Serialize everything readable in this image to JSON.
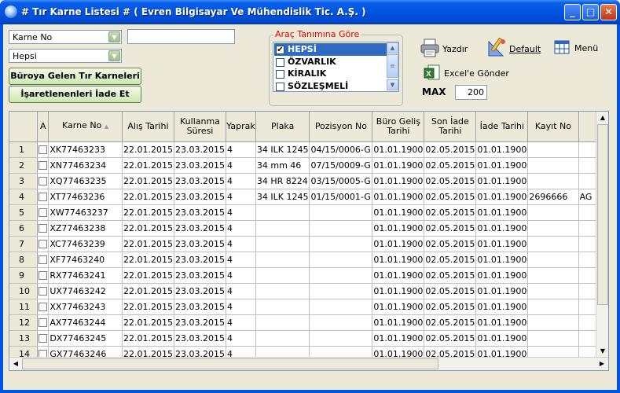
{
  "window": {
    "title": "# Tır Karne Listesi #  ( Evren Bilgisayar Ve Mühendislik Tic. A.Ş. )",
    "minimize_glyph": "_",
    "maximize_glyph": "□",
    "close_glyph": "✕"
  },
  "filters": {
    "field_combo_value": "Karne No",
    "search_value": "",
    "status_combo_value": "Hepsi",
    "arrow_glyph": "▼"
  },
  "buttons": {
    "incoming_label": "Büroya Gelen Tır Karneleri",
    "return_label": "İşaretlenenleri İade Et"
  },
  "vehicle_group": {
    "title": "Araç Tanımına Göre",
    "items": [
      {
        "label": "HEPSİ",
        "checked": true,
        "mark": "✔"
      },
      {
        "label": "ÖZVARLIK",
        "checked": false,
        "mark": ""
      },
      {
        "label": "KİRALIK",
        "checked": false,
        "mark": ""
      },
      {
        "label": "SÖZLEŞMELİ",
        "checked": false,
        "mark": ""
      }
    ]
  },
  "toolbar": {
    "print_label": "Yazdır",
    "default_label": "Default",
    "menu_label": "Menü",
    "excel_label": "Excel'e Gönder",
    "max_label": "MAX",
    "max_value": "200"
  },
  "table": {
    "headers": [
      "",
      "A",
      "Karne No",
      "Alış Tarihi",
      "Kullanma Süresi",
      "Yaprak",
      "Plaka",
      "Pozisyon No",
      "Büro Geliş Tarihi",
      "Son İade Tarihi",
      "İade Tarihi",
      "Kayıt No",
      ""
    ],
    "sort_glyph": "▲",
    "rows": [
      [
        "1",
        "XK77463233",
        "22.01.2015",
        "23.03.2015",
        "4",
        "34 ILK 1245",
        "04/15/0006-G",
        "01.01.1900",
        "02.05.2015",
        "01.01.1900",
        "",
        ""
      ],
      [
        "2",
        "XN77463234",
        "22.01.2015",
        "23.03.2015",
        "4",
        "34 mm 46",
        "07/15/0009-G",
        "01.01.1900",
        "02.05.2015",
        "01.01.1900",
        "",
        ""
      ],
      [
        "3",
        "XQ77463235",
        "22.01.2015",
        "23.03.2015",
        "4",
        "34 HR 8224",
        "03/15/0005-G",
        "01.01.1900",
        "02.05.2015",
        "01.01.1900",
        "",
        ""
      ],
      [
        "4",
        "XT77463236",
        "22.01.2015",
        "23.03.2015",
        "4",
        "34 ILK 1245",
        "01/15/0001-G",
        "01.01.1900",
        "02.05.2015",
        "01.01.1900",
        "2696666",
        "AG"
      ],
      [
        "5",
        "XW77463237",
        "22.01.2015",
        "23.03.2015",
        "4",
        "",
        "",
        "01.01.1900",
        "02.05.2015",
        "01.01.1900",
        "",
        ""
      ],
      [
        "6",
        "XZ77463238",
        "22.01.2015",
        "23.03.2015",
        "4",
        "",
        "",
        "01.01.1900",
        "02.05.2015",
        "01.01.1900",
        "",
        ""
      ],
      [
        "7",
        "XC77463239",
        "22.01.2015",
        "23.03.2015",
        "4",
        "",
        "",
        "01.01.1900",
        "02.05.2015",
        "01.01.1900",
        "",
        ""
      ],
      [
        "8",
        "XF77463240",
        "22.01.2015",
        "23.03.2015",
        "4",
        "",
        "",
        "01.01.1900",
        "02.05.2015",
        "01.01.1900",
        "",
        ""
      ],
      [
        "9",
        "RX77463241",
        "22.01.2015",
        "23.03.2015",
        "4",
        "",
        "",
        "01.01.1900",
        "02.05.2015",
        "01.01.1900",
        "",
        ""
      ],
      [
        "10",
        "UX77463242",
        "22.01.2015",
        "23.03.2015",
        "4",
        "",
        "",
        "01.01.1900",
        "02.05.2015",
        "01.01.1900",
        "",
        ""
      ],
      [
        "11",
        "XX77463243",
        "22.01.2015",
        "23.03.2015",
        "4",
        "",
        "",
        "01.01.1900",
        "02.05.2015",
        "01.01.1900",
        "",
        ""
      ],
      [
        "12",
        "AX77463244",
        "22.01.2015",
        "23.03.2015",
        "4",
        "",
        "",
        "01.01.1900",
        "02.05.2015",
        "01.01.1900",
        "",
        ""
      ],
      [
        "13",
        "DX77463245",
        "22.01.2015",
        "23.03.2015",
        "4",
        "",
        "",
        "01.01.1900",
        "02.05.2015",
        "01.01.1900",
        "",
        ""
      ],
      [
        "14",
        "GX77463246",
        "22.01.2015",
        "23.03.2015",
        "4",
        "",
        "",
        "01.01.1900",
        "02.05.2015",
        "01.01.1900",
        "",
        ""
      ]
    ]
  },
  "scroll": {
    "up": "▲",
    "down": "▼",
    "left": "◀",
    "right": "▶"
  }
}
